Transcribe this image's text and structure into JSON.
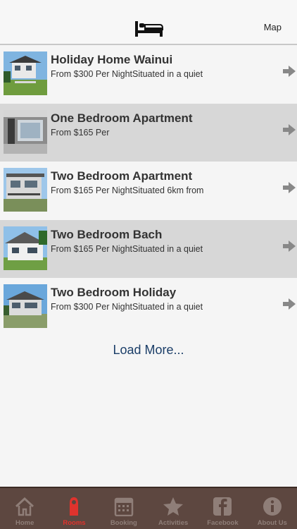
{
  "header": {
    "icon": "bed-icon",
    "map_label": "Map"
  },
  "listings": [
    {
      "title": "Holiday Home Wainui",
      "description": "From $300 Per NightSituated in a quiet",
      "thumb": "house-photo"
    },
    {
      "title": "One Bedroom Apartment",
      "description": "From $165 Per",
      "thumb": "apartment-photo"
    },
    {
      "title": "Two Bedroom Apartment",
      "description": "From $165 Per NightSituated 6km from",
      "thumb": "apartment-photo"
    },
    {
      "title": "Two Bedroom Bach",
      "description": "From $165 Per NightSituated in a quiet",
      "thumb": "bach-photo"
    },
    {
      "title": "Two Bedroom Holiday",
      "description": "From $300 Per NightSituated in a quiet",
      "thumb": "house-photo"
    }
  ],
  "load_more_label": "Load More...",
  "tabs": [
    {
      "label": "Home",
      "icon": "home-icon",
      "active": false
    },
    {
      "label": "Rooms",
      "icon": "door-hanger-icon",
      "active": true
    },
    {
      "label": "Booking",
      "icon": "calendar-icon",
      "active": false
    },
    {
      "label": "Activities",
      "icon": "star-icon",
      "active": false
    },
    {
      "label": "Facebook",
      "icon": "facebook-icon",
      "active": false
    },
    {
      "label": "About Us",
      "icon": "info-icon",
      "active": false
    }
  ],
  "colors": {
    "tabbar_bg": "#5d4740",
    "tab_inactive": "#8f7e78",
    "tab_active": "#e0332d",
    "link": "#1b3e68",
    "row_alt": "#d7d7d7"
  }
}
